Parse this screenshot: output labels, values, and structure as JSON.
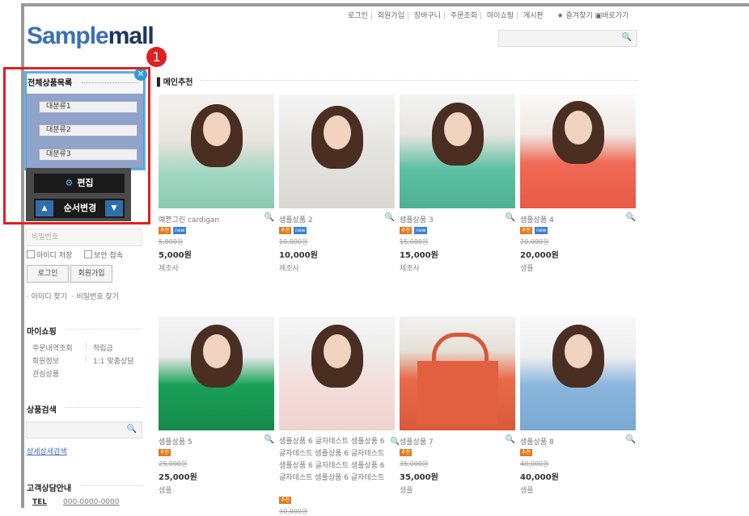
{
  "top_nav": {
    "links": [
      "로그인",
      "회원가입",
      "장바구니",
      "주문조회",
      "마이쇼핑",
      "게시판"
    ],
    "favorites": "즐겨찾기",
    "shortcut": "바로가기"
  },
  "logo": {
    "part1": "Sample",
    "part2": "mall"
  },
  "sidebar": {
    "category_title": "전체상품목록",
    "categories": [
      "대분류1",
      "대분류2",
      "대분류3"
    ],
    "edit_label": "편집",
    "order_label": "순서변경",
    "badge": "1",
    "password_placeholder": "비밀번호",
    "save_id": "아이디 저장",
    "secure": "보안 접속",
    "login_btn": "로그인",
    "join_btn": "회원가입",
    "find_id": "아이디 찾기",
    "find_pw": "비밀번호 찾기",
    "myshop_title": "마이쇼핑",
    "myshop_links": [
      "주문내역조회",
      "적립금",
      "회원정보",
      "1:1 맞춤상담",
      "관심상품"
    ],
    "search_title": "상품검색",
    "advanced_search": "상세상세검색",
    "cs_title": "고객상담안내",
    "tel_label": "TEL",
    "tel_value": "000-0000-0000"
  },
  "main": {
    "section_title": "메인추천",
    "products": [
      {
        "name": "예쁜그린 cardigan",
        "tags": [
          "추천",
          "new"
        ],
        "old": "5,000원",
        "price": "5,000원",
        "maker": "제조사"
      },
      {
        "name": "샘플상품 2",
        "tags": [
          "추천",
          "new"
        ],
        "old": "10,000원",
        "price": "10,000원",
        "maker": "제조사"
      },
      {
        "name": "샘플상품 3",
        "tags": [
          "추천",
          "new"
        ],
        "old": "15,000원",
        "price": "15,000원",
        "maker": "제조사"
      },
      {
        "name": "샘플상품 4",
        "tags": [
          "추천",
          "new"
        ],
        "old": "20,000원",
        "price": "20,000원",
        "maker": "샘플"
      },
      {
        "name": "샘플상품 5",
        "tags": [
          "추천"
        ],
        "old": "25,000원",
        "price": "25,000원",
        "maker": "샘플"
      },
      {
        "name": "샘플상품 6 글자테스트 샘플상품 6 글자테스트 샘플상품 6 글자테스트 샘플상품 6 글자테스트 샘플상품 6 글자테스트 샘플상품 6 글자테스트",
        "tags": [
          "추천"
        ],
        "old": "30,000원",
        "price": "",
        "maker": ""
      },
      {
        "name": "샘플상품 7",
        "tags": [
          "추천"
        ],
        "old": "35,000원",
        "price": "35,000원",
        "maker": "샘플"
      },
      {
        "name": "샘플상품 8",
        "tags": [
          "추천"
        ],
        "old": "40,000원",
        "price": "40,000원",
        "maker": "샘플"
      }
    ]
  }
}
